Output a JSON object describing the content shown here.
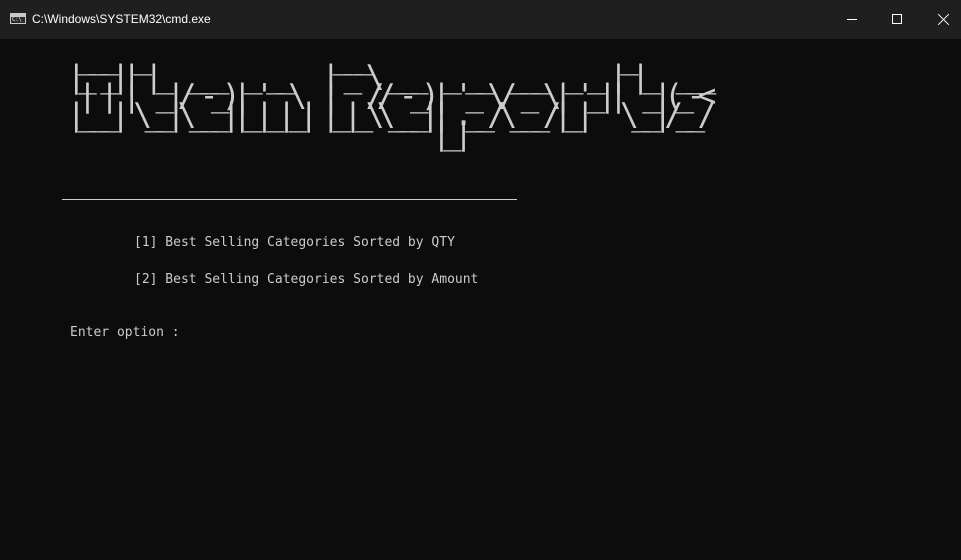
{
  "window": {
    "icon_text": "C:\\",
    "title": "C:\\Windows\\SYSTEM32\\cmd.exe",
    "controls": {
      "minimize": "—",
      "maximize": "☐",
      "close": "✕"
    }
  },
  "console": {
    "banner_lines": [
      " ___  _                 ___                       _          ",
      "|_ _|| |_  ___  _ __   | _ \\ ___  _ __  ___  _ _ | |_  ___  ",
      " | | |  _|/ -_)| '  \\  |   // -_)| '_ \\/ _ \\| '_||  _|(_-<  ",
      "|___| \\__|\\___||_|_|_| |_|_\\\\___|| .__/\\___/|_|   \\__|/__/  ",
      "                                 |_|                         "
    ],
    "options": [
      "[1] Best Selling Categories Sorted by QTY",
      "[2] Best Selling Categories Sorted by Amount"
    ],
    "prompt": "Enter option :"
  },
  "colors": {
    "titlebar": "#1f1f1f",
    "console_bg": "#0c0c0c",
    "console_fg": "#cccccc"
  }
}
